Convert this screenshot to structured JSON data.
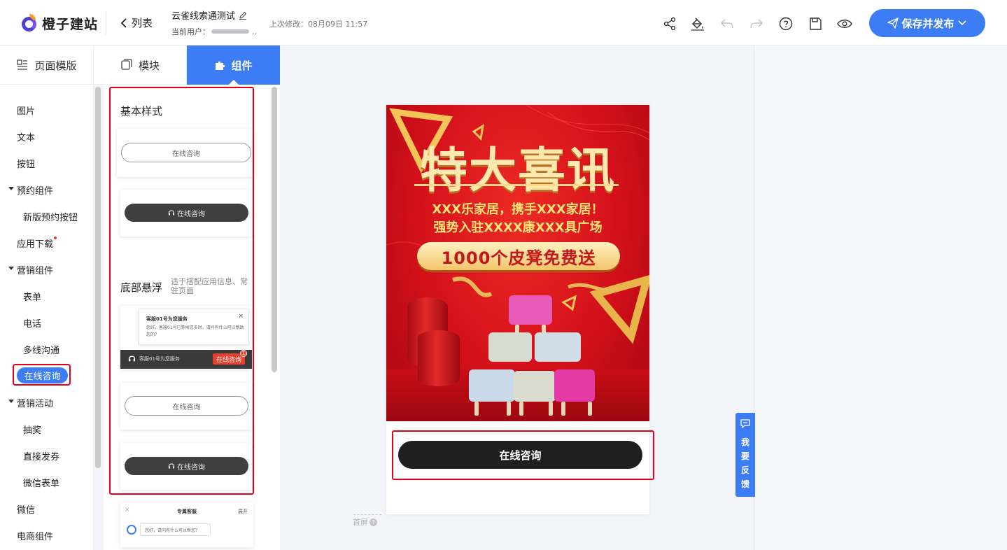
{
  "header": {
    "brand": "橙子建站",
    "back_label": "列表",
    "doc_title": "云雀线索通测试",
    "current_user_label": "当前用户：",
    "current_user_suffix": "..",
    "last_modified": "上次修改：08月09日 11:57",
    "publish_label": "保存并发布"
  },
  "tabs": [
    {
      "label": "页面模版"
    },
    {
      "label": "模块"
    },
    {
      "label": "组件"
    }
  ],
  "categories": {
    "image": "图片",
    "text": "文本",
    "button": "按钮",
    "booking_group": "预约组件",
    "booking_new_button": "新版预约按钮",
    "app_download": "应用下载",
    "marketing_group": "营销组件",
    "form": "表单",
    "phone": "电话",
    "multi_channel": "多线沟通",
    "online_consult": "在线咨询",
    "marketing_activity": "营销活动",
    "lottery": "抽奖",
    "direct_coupon": "直接发券",
    "wechat_form": "微信表单",
    "wechat": "微信",
    "ecommerce": "电商组件"
  },
  "component_panel": {
    "basic_title": "基本样式",
    "bottom_title": "底部悬浮",
    "bottom_desc": "适于搭配应用信息、常驻页面",
    "btn_label": "在线咨询",
    "chat_popup_title": "客服01号为您服务",
    "chat_popup_text": "您好，客服01号已等候您多时，请问有什么可以帮助您的？",
    "chat_popup_close": "×",
    "float_bar_label": "客服01号为您服务",
    "float_bar_badge": "1",
    "cs_close": "×",
    "cs_title": "专属客服",
    "cs_expand": "展开",
    "cs_message": "您好，请问有什么可以帮您？"
  },
  "canvas": {
    "banner_headline": "特大喜讯",
    "banner_line1": "XXX乐家居，携手XXX家居！",
    "banner_line2": "强势入驻XXXX康XXX具广场",
    "banner_pill": "1000个皮凳免费送",
    "cta_label": "在线咨询",
    "first_screen": "首屏",
    "first_screen_help": "?"
  },
  "feedback": {
    "chars": [
      "我",
      "要",
      "反",
      "馈"
    ]
  },
  "colors": {
    "primary": "#3c7df5",
    "highlight_red": "#e4001b",
    "banner_red": "#d3101a"
  }
}
